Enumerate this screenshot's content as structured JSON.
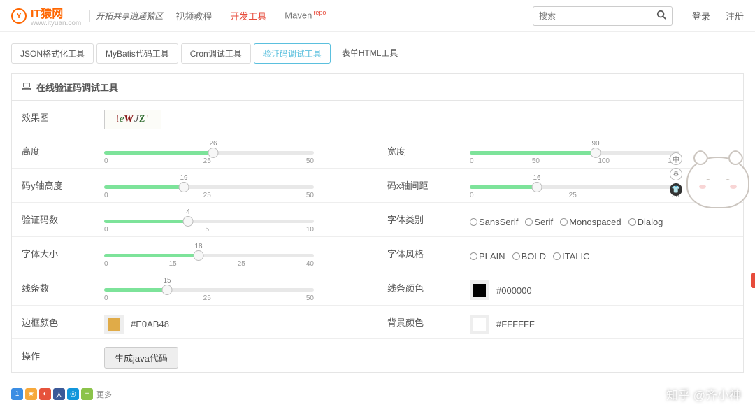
{
  "header": {
    "brand_name": "IT猿网",
    "brand_sub": "www.ityuan.com",
    "brand_slogan": "开拓共享逍遥猿区",
    "nav": [
      {
        "label": "视频教程",
        "active": false
      },
      {
        "label": "开发工具",
        "active": true
      },
      {
        "label": "Maven",
        "sup": "repo",
        "active": false
      }
    ],
    "search_placeholder": "搜索",
    "auth": {
      "login": "登录",
      "register": "注册"
    }
  },
  "tabs": [
    {
      "label": "JSON格式化工具",
      "active": false
    },
    {
      "label": "MyBatis代码工具",
      "active": false
    },
    {
      "label": "Cron调试工具",
      "active": false
    },
    {
      "label": "验证码调试工具",
      "active": true
    },
    {
      "label": "表单HTML工具",
      "plain": true
    }
  ],
  "panel_title": "在线验证码调试工具",
  "rows": {
    "preview": {
      "label": "效果图",
      "captcha": "leWJZ\\"
    },
    "height": {
      "label": "高度",
      "value": 26,
      "min": 0,
      "ticks": [
        "0",
        "25",
        "50"
      ],
      "pct": 52
    },
    "width": {
      "label": "宽度",
      "value": 90,
      "min": 0,
      "ticks": [
        "0",
        "50",
        "100",
        "150"
      ],
      "pct": 60
    },
    "codeY": {
      "label": "码y轴高度",
      "value": 19,
      "min": 0,
      "ticks": [
        "0",
        "25",
        "50"
      ],
      "pct": 38
    },
    "codeX": {
      "label": "码x轴间距",
      "value": 16,
      "min": 0,
      "ticks": [
        "0",
        "25",
        "50"
      ],
      "pct": 32
    },
    "codeCount": {
      "label": "验证码数",
      "value": 4,
      "min": 0,
      "ticks": [
        "0",
        "5",
        "10"
      ],
      "pct": 40
    },
    "fontFamily": {
      "label": "字体类别",
      "options": [
        "SansSerif",
        "Serif",
        "Monospaced",
        "Dialog"
      ]
    },
    "fontSize": {
      "label": "字体大小",
      "value": 18,
      "min": 0,
      "ticks": [
        "0",
        "15",
        "25",
        "40"
      ],
      "pct": 45
    },
    "fontStyle": {
      "label": "字体风格",
      "options": [
        "PLAIN",
        "BOLD",
        "ITALIC"
      ]
    },
    "lineCount": {
      "label": "线条数",
      "value": 15,
      "min": 0,
      "ticks": [
        "0",
        "25",
        "50"
      ],
      "pct": 30
    },
    "lineColor": {
      "label": "线条颜色",
      "hex": "#000000"
    },
    "borderColor": {
      "label": "边框颜色",
      "hex": "#E0AB48"
    },
    "bgColor": {
      "label": "背景颜色",
      "hex": "#FFFFFF"
    },
    "action": {
      "label": "操作",
      "button": "生成java代码"
    }
  },
  "share_more": "更多",
  "watermark": "知乎 @齐小神",
  "mascot_bubbles": [
    "中",
    "⚙",
    "👕"
  ]
}
